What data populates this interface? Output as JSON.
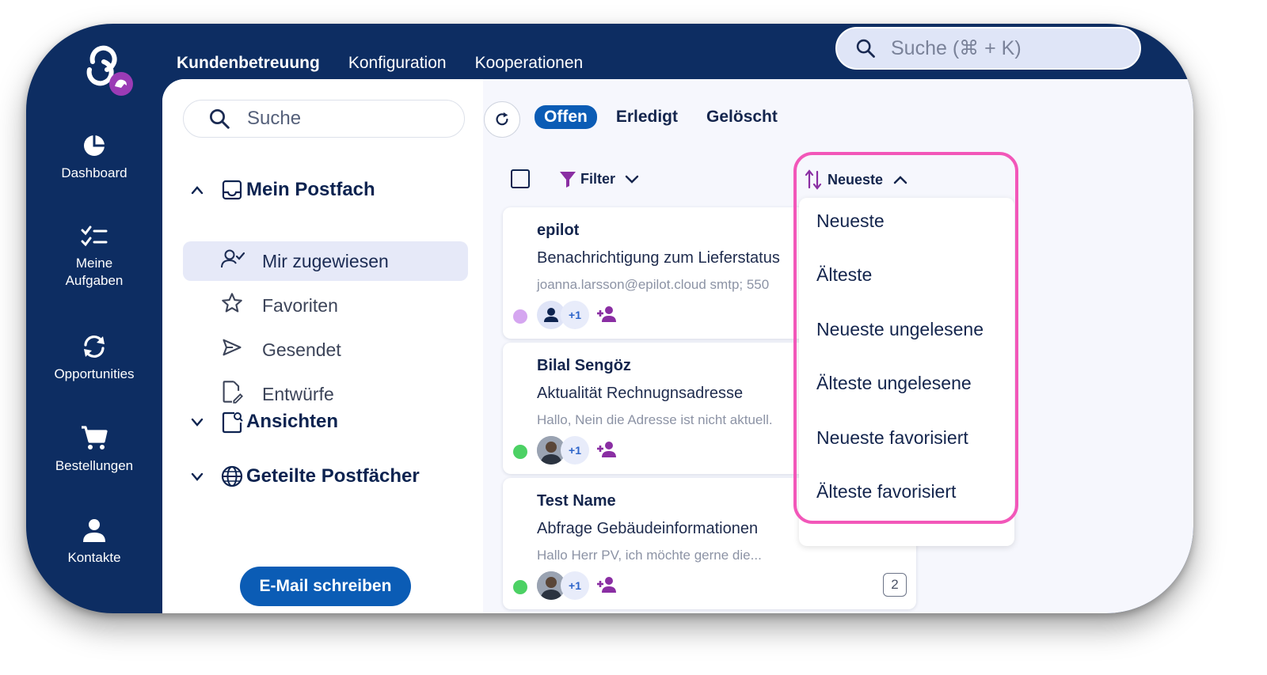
{
  "topnav": {
    "items": [
      "Kundenbetreuung",
      "Konfiguration",
      "Kooperationen"
    ],
    "search_placeholder": "Suche (⌘ + K)"
  },
  "sidebar": {
    "items": [
      {
        "label": "Dashboard",
        "icon": "pie-chart-icon"
      },
      {
        "label": "Meine Aufgaben",
        "icon": "task-list-icon"
      },
      {
        "label": "Opportunities",
        "icon": "sync-icon"
      },
      {
        "label": "Bestellungen",
        "icon": "cart-icon"
      },
      {
        "label": "Kontakte",
        "icon": "person-icon"
      }
    ]
  },
  "mailbox": {
    "search_placeholder": "Suche",
    "sections": {
      "mein_postfach": "Mein Postfach",
      "ansichten": "Ansichten",
      "geteilte": "Geteilte Postfächer"
    },
    "folders": [
      {
        "label": "Mir zugewiesen",
        "icon": "user-check-icon",
        "selected": true
      },
      {
        "label": "Favoriten",
        "icon": "star-icon"
      },
      {
        "label": "Gesendet",
        "icon": "send-icon"
      },
      {
        "label": "Entwürfe",
        "icon": "draft-icon"
      }
    ],
    "compose_label": "E-Mail schreiben"
  },
  "tabs": [
    "Offen",
    "Erledigt",
    "Gelöscht"
  ],
  "toolbar": {
    "filter_label": "Filter",
    "sort_label": "Neueste"
  },
  "threads": [
    {
      "from": "epilot",
      "subject": "Benachrichtigung zum Lieferstatus",
      "preview": "joanna.larsson@epilot.cloud smtp; 550",
      "status_color": "#d5a6f0",
      "avatar_extra": "+1"
    },
    {
      "from": "Bilal Sengöz",
      "subject": "Aktualität Rechnugnsadresse",
      "preview": "Hallo, Nein die Adresse ist nicht aktuell.",
      "status_color": "#4cd164",
      "avatar_extra": "+1"
    },
    {
      "from": "Test Name",
      "subject": "Abfrage Gebäudeinformationen",
      "preview": "Hallo Herr PV, ich möchte gerne die...",
      "status_color": "#4cd164",
      "avatar_extra": "+1",
      "count": "2"
    }
  ],
  "sort_menu": {
    "options": [
      "Neueste",
      "Älteste",
      "Neueste ungelesene",
      "Älteste ungelesene",
      "Neueste favorisiert",
      "Älteste favorisiert"
    ]
  },
  "colors": {
    "navy": "#0d2d62",
    "accent_blue": "#0b5cb5",
    "highlight": "#f257b9",
    "purple": "#8a2ea3"
  }
}
